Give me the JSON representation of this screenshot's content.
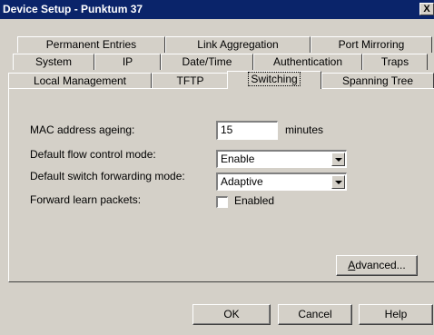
{
  "window": {
    "title": "Device Setup - Punktum 37",
    "close_glyph": "X"
  },
  "tabs": {
    "row1": [
      {
        "label": "Permanent Entries"
      },
      {
        "label": "Link Aggregation"
      },
      {
        "label": "Port Mirroring"
      }
    ],
    "row2": [
      {
        "label": "System"
      },
      {
        "label": "IP"
      },
      {
        "label": "Date/Time"
      },
      {
        "label": "Authentication"
      },
      {
        "label": "Traps"
      }
    ],
    "row3": [
      {
        "label": "Local Management"
      },
      {
        "label": "TFTP"
      },
      {
        "label": "Switching"
      },
      {
        "label": "Spanning Tree"
      }
    ],
    "selected": "Switching"
  },
  "switching": {
    "mac_ageing": {
      "label": "MAC address ageing:",
      "value": "15",
      "unit": "minutes"
    },
    "flow_control": {
      "label": "Default flow control mode:",
      "value": "Enable"
    },
    "forwarding": {
      "label": "Default switch forwarding mode:",
      "value": "Adaptive"
    },
    "learn_packets": {
      "label": "Forward learn packets:",
      "checkbox_label": "Enabled",
      "checked": false
    },
    "advanced_label": "Advanced..."
  },
  "buttons": {
    "ok": "OK",
    "cancel": "Cancel",
    "help": "Help"
  },
  "colors": {
    "titlebar": "#0a246a",
    "face": "#d4d0c8"
  }
}
